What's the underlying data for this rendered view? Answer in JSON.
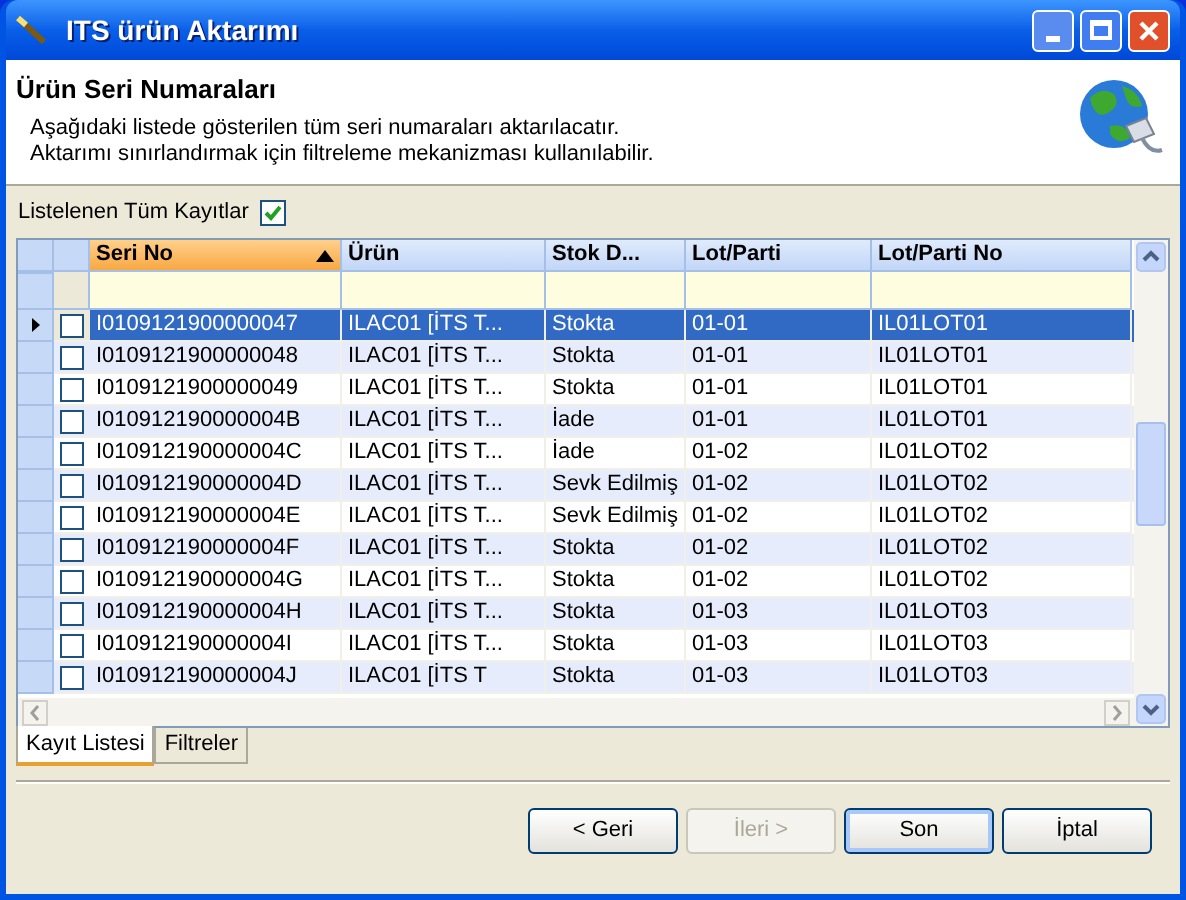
{
  "window": {
    "title": "ITS ürün Aktarımı"
  },
  "header": {
    "title": "Ürün Seri Numaraları",
    "lines": [
      "Aşağıdaki listede gösterilen tüm seri numaraları aktarılacatır.",
      "Aktarımı sınırlandırmak için filtreleme mekanizması kullanılabilir."
    ]
  },
  "all_records": {
    "label": "Listelenen Tüm Kayıtlar",
    "checked": true
  },
  "table": {
    "columns": [
      {
        "label": "Seri No",
        "sorted": true
      },
      {
        "label": "Ürün",
        "sorted": false
      },
      {
        "label": "Stok D...",
        "sorted": false
      },
      {
        "label": "Lot/Parti",
        "sorted": false
      },
      {
        "label": "Lot/Parti No",
        "sorted": false
      }
    ],
    "rows": [
      {
        "selected": true,
        "checked": false,
        "cells": [
          "I0109121900000047",
          "ILAC01 [İTS T...",
          "Stokta",
          "01-01",
          "IL01LOT01"
        ]
      },
      {
        "selected": false,
        "checked": false,
        "cells": [
          "I0109121900000048",
          "ILAC01 [İTS T...",
          "Stokta",
          "01-01",
          "IL01LOT01"
        ]
      },
      {
        "selected": false,
        "checked": false,
        "cells": [
          "I0109121900000049",
          "ILAC01 [İTS T...",
          "Stokta",
          "01-01",
          "IL01LOT01"
        ]
      },
      {
        "selected": false,
        "checked": false,
        "cells": [
          "I010912190000004B",
          "ILAC01 [İTS T...",
          "İade",
          "01-01",
          "IL01LOT01"
        ]
      },
      {
        "selected": false,
        "checked": false,
        "cells": [
          "I010912190000004C",
          "ILAC01 [İTS T...",
          "İade",
          "01-02",
          "IL01LOT02"
        ]
      },
      {
        "selected": false,
        "checked": false,
        "cells": [
          "I010912190000004D",
          "ILAC01 [İTS T...",
          "Sevk Edilmiş",
          "01-02",
          "IL01LOT02"
        ]
      },
      {
        "selected": false,
        "checked": false,
        "cells": [
          "I010912190000004E",
          "ILAC01 [İTS T...",
          "Sevk Edilmiş",
          "01-02",
          "IL01LOT02"
        ]
      },
      {
        "selected": false,
        "checked": false,
        "cells": [
          "I010912190000004F",
          "ILAC01 [İTS T...",
          "Stokta",
          "01-02",
          "IL01LOT02"
        ]
      },
      {
        "selected": false,
        "checked": false,
        "cells": [
          "I010912190000004G",
          "ILAC01 [İTS T...",
          "Stokta",
          "01-02",
          "IL01LOT02"
        ]
      },
      {
        "selected": false,
        "checked": false,
        "cells": [
          "I010912190000004H",
          "ILAC01 [İTS T...",
          "Stokta",
          "01-03",
          "IL01LOT03"
        ]
      },
      {
        "selected": false,
        "checked": false,
        "cells": [
          "I010912190000004I",
          "ILAC01 [İTS T...",
          "Stokta",
          "01-03",
          "IL01LOT03"
        ]
      },
      {
        "selected": false,
        "checked": false,
        "cells": [
          "I010912190000004J",
          "ILAC01 [İTS T",
          "Stokta",
          "01-03",
          "IL01LOT03"
        ]
      }
    ]
  },
  "tabs": [
    {
      "label": "Kayıt Listesi",
      "selected": true
    },
    {
      "label": "Filtreler",
      "selected": false
    }
  ],
  "buttons": [
    {
      "label": "< Geri",
      "disabled": false,
      "default": false
    },
    {
      "label": "İleri >",
      "disabled": true,
      "default": false
    },
    {
      "label": "Son",
      "disabled": false,
      "default": true
    },
    {
      "label": "İptal",
      "disabled": false,
      "default": false
    }
  ]
}
